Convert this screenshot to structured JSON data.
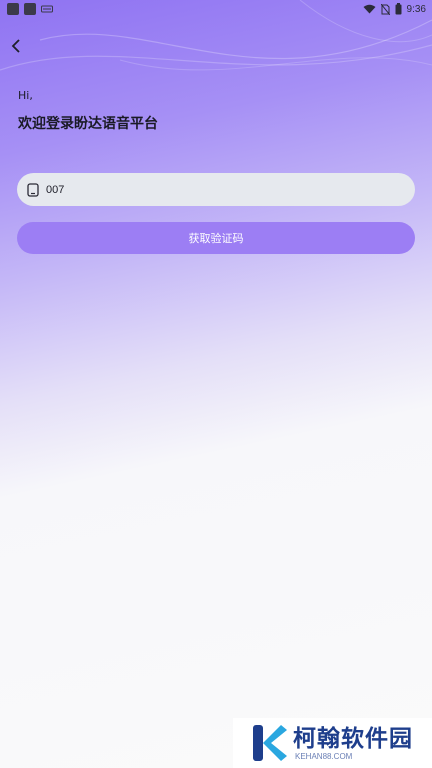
{
  "status_bar": {
    "time": "9:36",
    "icons": [
      "notification-icon",
      "notification-icon",
      "keyboard-icon",
      "wifi-icon",
      "no-sim-icon",
      "battery-icon"
    ]
  },
  "header": {
    "back_icon": "chevron-left-icon"
  },
  "greeting": {
    "hi": "Hi,",
    "welcome": "欢迎登录盼达语音平台"
  },
  "phone_field": {
    "icon": "phone-icon",
    "value": "007",
    "placeholder": ""
  },
  "actions": {
    "get_code_label": "获取验证码"
  },
  "watermark": {
    "title": "柯翰软件园",
    "subtitle": "KEHAN88.COM"
  },
  "colors": {
    "accent": "#9c7ef4",
    "gradient_top": "#8f73f2",
    "input_bg": "#e6e9ee",
    "page_bg": "#fafafa"
  }
}
